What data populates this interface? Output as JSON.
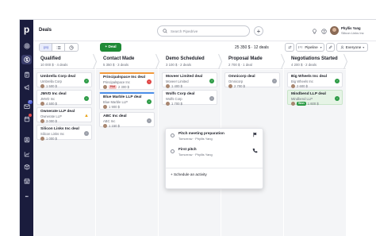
{
  "app": {
    "logo": "p",
    "page_title": "Deals"
  },
  "sidebar": {
    "items": [
      {
        "icon": "target-icon"
      },
      {
        "icon": "dollar-icon",
        "active": true
      },
      {
        "icon": "clipboard-icon"
      },
      {
        "icon": "megaphone-icon"
      },
      {
        "icon": "mail-icon",
        "badge": "27"
      },
      {
        "icon": "calendar-icon",
        "badge_dot": true
      },
      {
        "icon": "contacts-icon"
      },
      {
        "icon": "chart-icon"
      },
      {
        "icon": "box-icon"
      },
      {
        "icon": "store-icon"
      },
      {
        "icon": "more-icon",
        "label": "•••"
      }
    ]
  },
  "header": {
    "search_placeholder": "Search Pipedrive",
    "add_label": "+",
    "user_name": "Phyllis Yang",
    "user_company": "Silicon Links Inc"
  },
  "toolbar": {
    "deal_button": "+ Deal",
    "totals": "25 350 $ · 12 deals",
    "pipeline_label": "Pipeline",
    "everyone_label": "Everyone"
  },
  "columns": [
    {
      "title": "Qualified",
      "summary": "10 000 $ · 4 deals",
      "cards": [
        {
          "title": "Umbrella Corp deal",
          "company": "Umbrella Corp",
          "value": "1 500 $",
          "status": "green",
          "status_glyph": "›"
        },
        {
          "title": "JMVD Inc deal",
          "company": "JMVD Inc",
          "value": "4 500 $",
          "status": "green",
          "status_glyph": "›"
        },
        {
          "title": "Ownerate LLP deal",
          "company": "Ownerate LLP",
          "value": "3 000 $",
          "status": "warn",
          "status_glyph": "▲"
        },
        {
          "title": "Silicon Links Inc deal",
          "company": "Silicon Links Inc",
          "value": "1 000 $",
          "status": "grey",
          "status_glyph": "›"
        }
      ]
    },
    {
      "title": "Contact Made",
      "summary": "5 350 $ · 3 deals",
      "cards": [
        {
          "title": "Principalspace Inc deal",
          "company": "Principalspace Inc",
          "value": "2 300 $",
          "tag": "Hot",
          "status": "red",
          "status_glyph": "‹",
          "accent": "orange"
        },
        {
          "title": "Blue Marble LLP deal",
          "company": "Blue Marble LLP",
          "value": "1 900 $",
          "status": "green",
          "status_glyph": "›",
          "accent": "blue"
        },
        {
          "title": "ABC Inc deal",
          "company": "ABC Inc",
          "value": "1 150 $",
          "status": "grey",
          "status_glyph": "›"
        }
      ]
    },
    {
      "title": "Demo Scheduled",
      "summary": "3 100 $ · 2 deals",
      "cards": [
        {
          "title": "Moveer Limited deal",
          "company": "Moveer Limited",
          "value": "1 400 $",
          "status": "green",
          "status_glyph": "›"
        },
        {
          "title": "Wolfs Corp deal",
          "company": "Wolfs Corp",
          "value": "1 700 $",
          "status": "grey",
          "status_glyph": "›"
        }
      ]
    },
    {
      "title": "Proposal Made",
      "summary": "2 700 $ · 1 deal",
      "cards": [
        {
          "title": "Omnicorp deal",
          "company": "Omnicorp",
          "value": "2 700 $",
          "status": "grey",
          "status_glyph": "›"
        }
      ]
    },
    {
      "title": "Negotiations Started",
      "summary": "4 200 $ · 2 deals",
      "cards": [
        {
          "title": "Big Wheels Inc deal",
          "company": "Big Wheels Inc",
          "value": "2 600 $",
          "status": "green",
          "status_glyph": "›"
        },
        {
          "title": "Mindbend LLP deal",
          "company": "Mindbend LLP",
          "value": "1 600 $",
          "tag": "Won",
          "status": "green",
          "status_glyph": "›",
          "highlight": true
        }
      ]
    }
  ],
  "activity_popover": {
    "items": [
      {
        "title": "Pitch meeting preparation",
        "meta": "Tomorrow · Phyllis Yang",
        "icon": "flag-icon"
      },
      {
        "title": "First pitch",
        "meta": "Tomorrow · Phyllis Yang",
        "icon": "phone-icon"
      }
    ],
    "schedule_label": "+  Schedule an activity"
  }
}
